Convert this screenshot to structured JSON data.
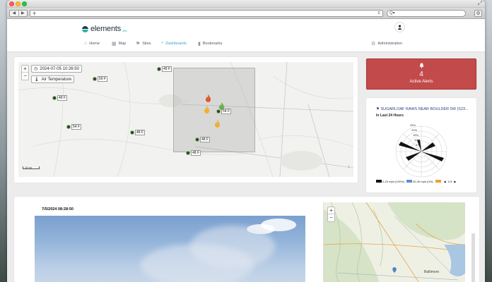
{
  "browser": {
    "nav_back": "◀",
    "nav_forward": "▶",
    "new_tab": "+",
    "reload": "c",
    "search_prefix": "Q▾",
    "gear": "⚙",
    "expand": "⤢"
  },
  "app": {
    "logo_text": "elements",
    "logo_sub": "360",
    "user_icon": "user-icon"
  },
  "nav": [
    {
      "label": "Home",
      "icon": "home-icon",
      "active": false
    },
    {
      "label": "Map",
      "icon": "map-icon",
      "active": false
    },
    {
      "label": "Sites",
      "icon": "sites-icon",
      "active": false
    },
    {
      "label": "Dashboards",
      "icon": "dashboard-icon",
      "active": true
    },
    {
      "label": "Bookmarks",
      "icon": "bookmark-icon",
      "active": false
    },
    {
      "label": "Administration",
      "icon": "gear-icon",
      "active": false
    }
  ],
  "map": {
    "timestamp": "2024-07-05 10:26:50",
    "layer": "Air Temperature",
    "zoom_in": "+",
    "zoom_out": "−",
    "scale": "10 mi",
    "info": "i",
    "markers": [
      "49 F",
      "50 F",
      "49 F",
      "54 F",
      "48 F",
      "54 F",
      "48 F",
      "48 F"
    ]
  },
  "alerts": {
    "count": "4",
    "label": "Active Alerts",
    "color": "#c24a4a"
  },
  "wind": {
    "title": "SUGARLOAF RAWS NEAR BOULDER 5W (S23...",
    "subtitle": "In Last 24 Hours",
    "ring_labels": [
      "25%",
      "20%",
      "15%",
      "10%",
      "5%"
    ],
    "legend": [
      {
        "label": "0-20 mph (100%)",
        "color": "#111111"
      },
      {
        "label": "20-40 mph (0%)",
        "color": "#5b8fd6"
      },
      {
        "label": "",
        "color": "#f0a030"
      }
    ],
    "pager": "1/3"
  },
  "camera": {
    "timestamp": "7/5/2024 08:28:50"
  },
  "topo": {
    "zoom_in": "+",
    "zoom_out": "−",
    "city": "Baltimore"
  }
}
